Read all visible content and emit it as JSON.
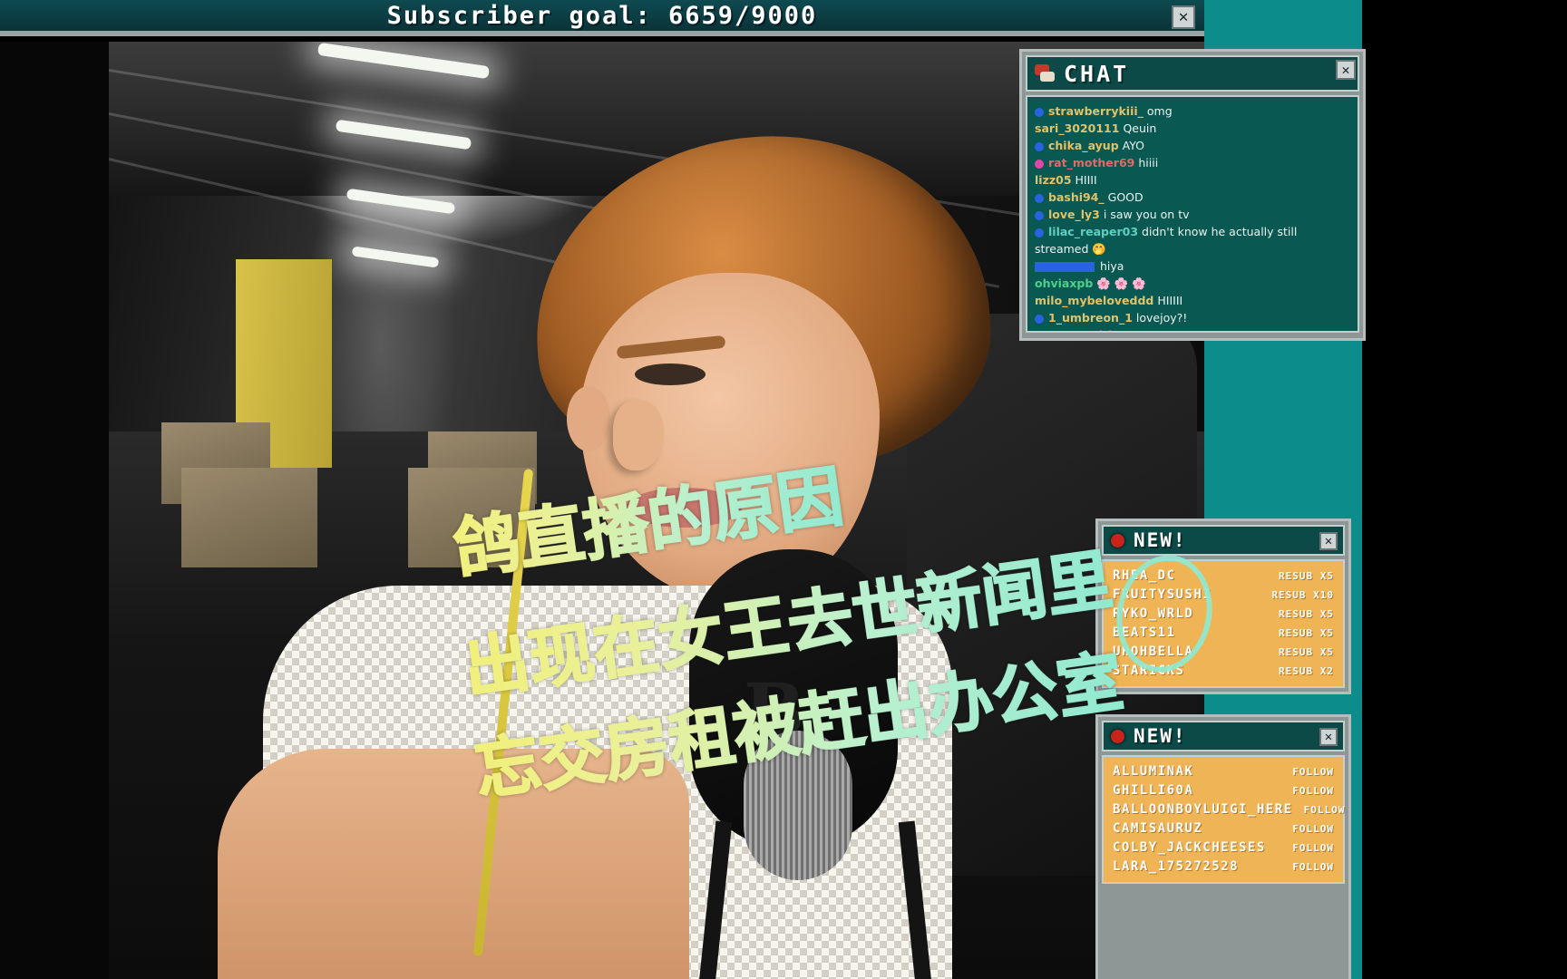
{
  "topbar": {
    "goal_label": "Subscriber goal:  6659/9000",
    "close_icon": "✕"
  },
  "chat": {
    "title": "CHAT",
    "title_icon": "speech-bubble-icon",
    "close_icon": "✕",
    "messages": [
      {
        "badge": "#2a63e0",
        "user": "strawberrykiii_",
        "text": "omg",
        "ucolor": "#e0c26a"
      },
      {
        "badge": "",
        "user": "sari_3020111",
        "text": "Qeuin",
        "ucolor": "#e0c26a"
      },
      {
        "badge": "#2a63e0",
        "user": "chika_ayup",
        "text": "AYO",
        "ucolor": "#e0c26a"
      },
      {
        "badge": "#e048a8",
        "user": "rat_mother69",
        "text": "hiiii",
        "ucolor": "#e06a6a"
      },
      {
        "badge": "",
        "user": "lizz05",
        "text": "HIIII",
        "ucolor": "#e0c26a"
      },
      {
        "badge": "#2a63e0",
        "user": "bashi94_",
        "text": "GOOD",
        "ucolor": "#e0c26a"
      },
      {
        "badge": "#2a63e0",
        "user": "love_ly3",
        "text": "i saw you on tv",
        "ucolor": "#e0c26a"
      },
      {
        "badge": "#2a63e0",
        "user": "lilac_reaper03",
        "text": "didn't know he actually still streamed 🤭",
        "ucolor": "#5fd0c0"
      },
      {
        "badge": "",
        "user": "",
        "text": "hiya",
        "ucolor": "#e0c26a",
        "name_redacted": true
      },
      {
        "badge": "",
        "user": "ohviaxpb",
        "text": "🌸 🌸 🌸",
        "ucolor": "#4fd08a"
      },
      {
        "badge": "",
        "user": "milo_mybeloveddd",
        "text": "HIIIII",
        "ucolor": "#e0c26a"
      },
      {
        "badge": "#2a63e0",
        "user": "1_umbreon_1",
        "text": "lovejoy?!",
        "ucolor": "#e0c26a"
      },
      {
        "badge": "#e048a8",
        "user": "tx_poggirl",
        "text": "SLAYY",
        "ucolor": "#e06a6a"
      }
    ]
  },
  "resub_panel": {
    "title": "NEW!",
    "status_icon": "red-dot-icon",
    "close_icon": "✕",
    "rows": [
      {
        "name": "RHEA_DC",
        "amount": "RESUB X5"
      },
      {
        "name": "FRUITYSUSHI",
        "amount": "RESUB X10"
      },
      {
        "name": "RYKO_WRLD",
        "amount": "RESUB X5"
      },
      {
        "name": "BEATS11",
        "amount": "RESUB X5"
      },
      {
        "name": "UHOHBELLA",
        "amount": "RESUB X5"
      },
      {
        "name": "STARICKS",
        "amount": "RESUB X2"
      }
    ]
  },
  "follow_panel": {
    "title": "NEW!",
    "status_icon": "red-dot-icon",
    "close_icon": "✕",
    "rows": [
      {
        "name": "ALLUMINAK",
        "amount": "FOLLOW"
      },
      {
        "name": "GHILLI60A",
        "amount": "FOLLOW"
      },
      {
        "name": "BALLOONBOYLUIGI_HERE",
        "amount": "FOLLOW"
      },
      {
        "name": "CAMISAURUZ",
        "amount": "FOLLOW"
      },
      {
        "name": "COLBY_JACKCHEESES",
        "amount": "FOLLOW"
      },
      {
        "name": "LARA_175272528",
        "amount": "FOLLOW"
      }
    ]
  },
  "subtitles": {
    "line1": "鸽直播的原因",
    "line2": "出现在女王去世新闻里",
    "line3": "忘交房租被赶出办公室"
  },
  "colors": {
    "topbar_teal": "#0e4a50",
    "panel_teal": "#0c4a48",
    "chat_body": "#0a5852",
    "panel_orange": "#eeb455",
    "frame_gray": "#b6bebd",
    "stream_teal": "#0d8c8c",
    "alert_red": "#c8241c"
  }
}
